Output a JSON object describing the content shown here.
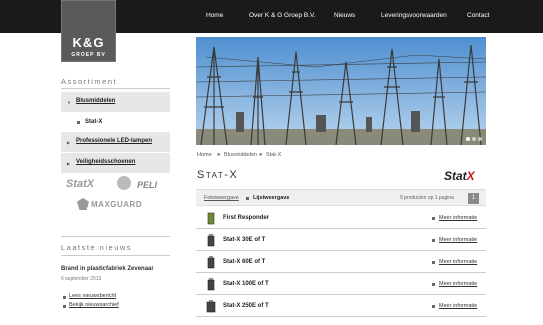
{
  "logo": {
    "main": "K&G",
    "sub": "GROEP BV"
  },
  "nav": [
    "Home",
    "Over K & G Groep B.V.",
    "Nieuws",
    "Leveringsvoorwaarden",
    "Contact"
  ],
  "breadcrumb": [
    "Home",
    "Blusmiddelen",
    "Stat-X"
  ],
  "page_title": "Stat-X",
  "brand_logo": {
    "text": "Stat",
    "x": "X"
  },
  "view": {
    "photo": "Fotoweergave",
    "list": "Lijstweergave",
    "count": "9 producten op 1 pagina",
    "page": "1"
  },
  "products": [
    {
      "name": "First Responder",
      "more": "Meer informatie"
    },
    {
      "name": "Stat-X 30E of T",
      "more": "Meer informatie"
    },
    {
      "name": "Stat-X 60E of T",
      "more": "Meer informatie"
    },
    {
      "name": "Stat-X 100E of T",
      "more": "Meer informatie"
    },
    {
      "name": "Stat-X 250E of T",
      "more": "Meer informatie"
    }
  ],
  "sidebar": {
    "title": "Assortiment",
    "items": [
      {
        "label": "Blusmiddelen",
        "sub": "Stat-X"
      },
      {
        "label": "Professionele LED-lampen"
      },
      {
        "label": "Veiligheidsschoenen"
      }
    ],
    "brands": [
      "StatX",
      "PELI",
      "MAXGUARD"
    ]
  },
  "news": {
    "title": "Laatste nieuws",
    "headline": "Brand in plasticfabriek Zevenaar",
    "date": "6 september 2013",
    "links": [
      "Lees nieuwsbericht",
      "Bekijk nieuwsarchief"
    ]
  },
  "colors": {
    "topbar": "#1a1a1a",
    "accent": "#c0171b",
    "sidebar": "#e7e7e7"
  }
}
